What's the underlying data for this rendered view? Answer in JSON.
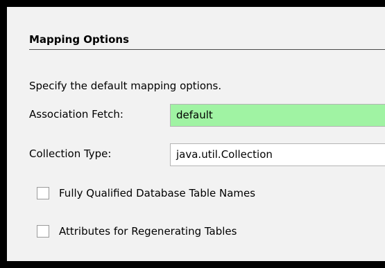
{
  "section": {
    "title": "Mapping Options",
    "description": "Specify the default mapping options."
  },
  "fields": {
    "association_fetch": {
      "label": "Association Fetch:",
      "value": "default"
    },
    "collection_type": {
      "label": "Collection Type:",
      "value": "java.util.Collection"
    }
  },
  "checkboxes": [
    {
      "label": "Fully Qualified Database Table Names",
      "checked": false
    },
    {
      "label": "Attributes for Regenerating Tables",
      "checked": false
    }
  ],
  "colors": {
    "highlight_field": "#a0f3a3",
    "panel_background": "#f2f2f2"
  }
}
